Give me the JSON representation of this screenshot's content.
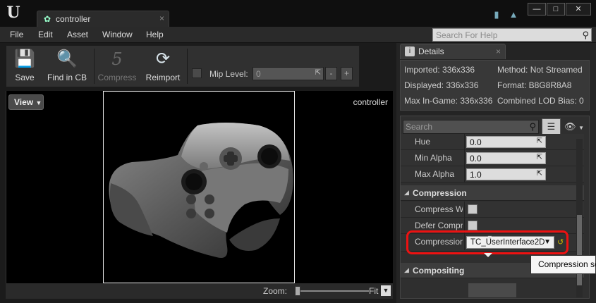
{
  "window": {
    "tab_title": "controller",
    "tab_close": "×",
    "logo": "U",
    "minimize": "—",
    "maximize": "□",
    "close": "✕"
  },
  "menu": {
    "items": [
      "File",
      "Edit",
      "Asset",
      "Window",
      "Help"
    ],
    "search_placeholder": "Search For Help"
  },
  "toolbar": {
    "buttons": [
      {
        "label": "Save",
        "icon": "floppy-disk-icon"
      },
      {
        "label": "Find in CB",
        "icon": "magnifier-icon"
      },
      {
        "label": "Compress",
        "icon": "compress-icon"
      },
      {
        "label": "Reimport",
        "icon": "reimport-icon"
      }
    ],
    "mip_label": "Mip Level:",
    "mip_value": "0",
    "minus": "-",
    "plus": "+"
  },
  "viewport": {
    "view_button": "View",
    "texture_name": "controller",
    "zoom_label": "Zoom:",
    "zoom_value": "Fit"
  },
  "details": {
    "tab_label": "Details",
    "tab_close": "×",
    "info": {
      "imported": "Imported: 336x336",
      "method": "Method: Not Streamed",
      "displayed": "Displayed: 336x336",
      "format": "Format: B8G8R8A8",
      "max_in_game": "Max In-Game: 336x336",
      "lod_bias": "Combined LOD Bias: 0"
    },
    "search_placeholder": "Search",
    "props": {
      "hue_label": "Hue",
      "hue_value": "0.0",
      "min_alpha_label": "Min Alpha",
      "min_alpha_value": "0.0",
      "max_alpha_label": "Max Alpha",
      "max_alpha_value": "1.0",
      "compression_category": "Compression",
      "compress_without_alpha": "Compress Wi",
      "defer_compression": "Defer Compre",
      "compression_settings_label": "Compression",
      "compression_settings_value": "TC_UserInterface2D",
      "compositing_category": "Compositing"
    }
  },
  "tooltip": {
    "text": "Compression se"
  }
}
